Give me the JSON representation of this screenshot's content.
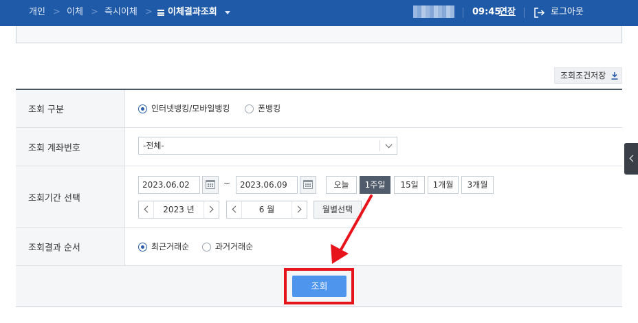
{
  "header": {
    "breadcrumbs": [
      "개인",
      "이체",
      "즉시이체"
    ],
    "current_menu": "이체결과조회",
    "clock": "09:45",
    "extend_label": "연장",
    "logout_label": "로그아웃"
  },
  "save_condition_label": "조회조건저장",
  "form": {
    "type": {
      "label": "조회 구분",
      "options": [
        "인터넷뱅킹/모바일뱅킹",
        "폰뱅킹"
      ],
      "selected": "인터넷뱅킹/모바일뱅킹"
    },
    "account": {
      "label": "조회 계좌번호",
      "value": "-전체-"
    },
    "period": {
      "label": "조회기간 선택",
      "start_date": "2023.06.02",
      "end_date": "2023.06.09",
      "separator": "~",
      "presets": [
        "오늘",
        "1주일",
        "15일",
        "1개월",
        "3개월"
      ],
      "active_preset": "1주일",
      "year": "2023 년",
      "month": "6 월",
      "month_select_label": "월별선택"
    },
    "order": {
      "label": "조회결과 순서",
      "options": [
        "최근거래순",
        "과거거래순"
      ],
      "selected": "최근거래순"
    }
  },
  "search_button_label": "조회",
  "colors": {
    "header_bg": "#1f5aa8",
    "primary_button": "#4e95ee",
    "active_preset_bg": "#505b6b",
    "annotation_red": "#e8141b"
  }
}
